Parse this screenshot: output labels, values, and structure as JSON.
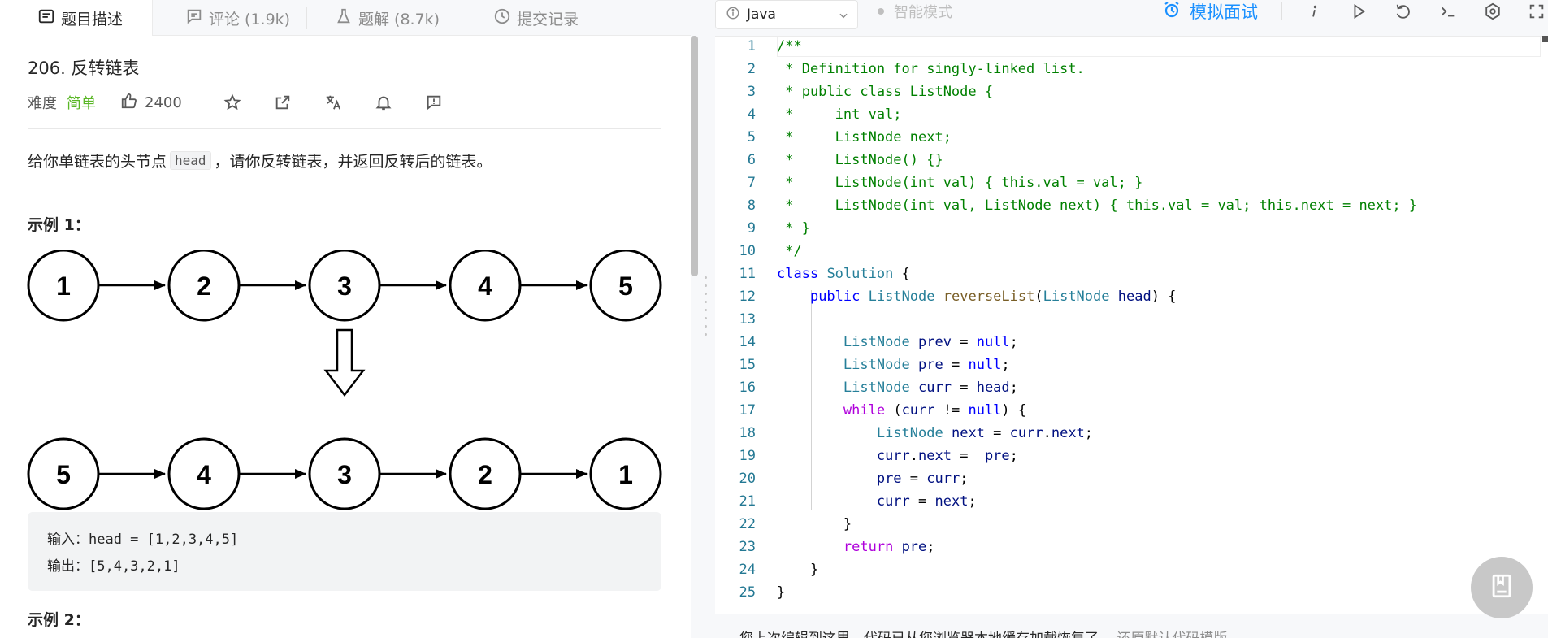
{
  "tabs": [
    {
      "label": "题目描述",
      "icon": "description-icon"
    },
    {
      "label": "评论 (1.9k)",
      "icon": "comment-icon"
    },
    {
      "label": "题解 (8.7k)",
      "icon": "solution-flask-icon"
    },
    {
      "label": "提交记录",
      "icon": "history-clock-icon"
    }
  ],
  "problem": {
    "title": "206. 反转链表",
    "difficulty_label": "难度",
    "difficulty": "简单",
    "likes": "2400",
    "description_prefix": "给你单链表的头节点",
    "description_code": "head",
    "description_suffix": "，请你反转链表，并返回反转后的链表。",
    "example1_title": "示例 1：",
    "example1_input": "输入：head = [1,2,3,4,5]",
    "example1_output": "输出：[5,4,3,2,1]",
    "example2_title": "示例 2："
  },
  "diagram": {
    "top_row": [
      "1",
      "2",
      "3",
      "4",
      "5"
    ],
    "bottom_row": [
      "5",
      "4",
      "3",
      "2",
      "1"
    ]
  },
  "toolbar": {
    "language": "Java",
    "smart_mode": "智能模式",
    "mock_interview": "模拟面试",
    "accent_color": "#1a90ff"
  },
  "editor": {
    "line_numbers": [
      "1",
      "2",
      "3",
      "4",
      "5",
      "6",
      "7",
      "8",
      "9",
      "10",
      "11",
      "12",
      "13",
      "14",
      "15",
      "16",
      "17",
      "18",
      "19",
      "20",
      "21",
      "22",
      "23",
      "24",
      "25"
    ],
    "lines": [
      "/**",
      " * Definition for singly-linked list.",
      " * public class ListNode {",
      " *     int val;",
      " *     ListNode next;",
      " *     ListNode() {}",
      " *     ListNode(int val) { this.val = val; }",
      " *     ListNode(int val, ListNode next) { this.val = val; this.next = next; }",
      " * }",
      " */",
      "class Solution {",
      "    public ListNode reverseList(ListNode head) {",
      "",
      "        ListNode prev = null;",
      "        ListNode pre = null;",
      "        ListNode curr = head;",
      "        while (curr != null) {",
      "            ListNode next = curr.next;",
      "            curr.next =  pre;",
      "            pre = curr;",
      "            curr = next;",
      "        }",
      "        return pre;",
      "    }",
      "}"
    ]
  },
  "bottom_hint": {
    "text": "您上次编辑到这里，代码已从您浏览器本地缓存加载恢复了。",
    "link": "还原默认代码模版"
  }
}
